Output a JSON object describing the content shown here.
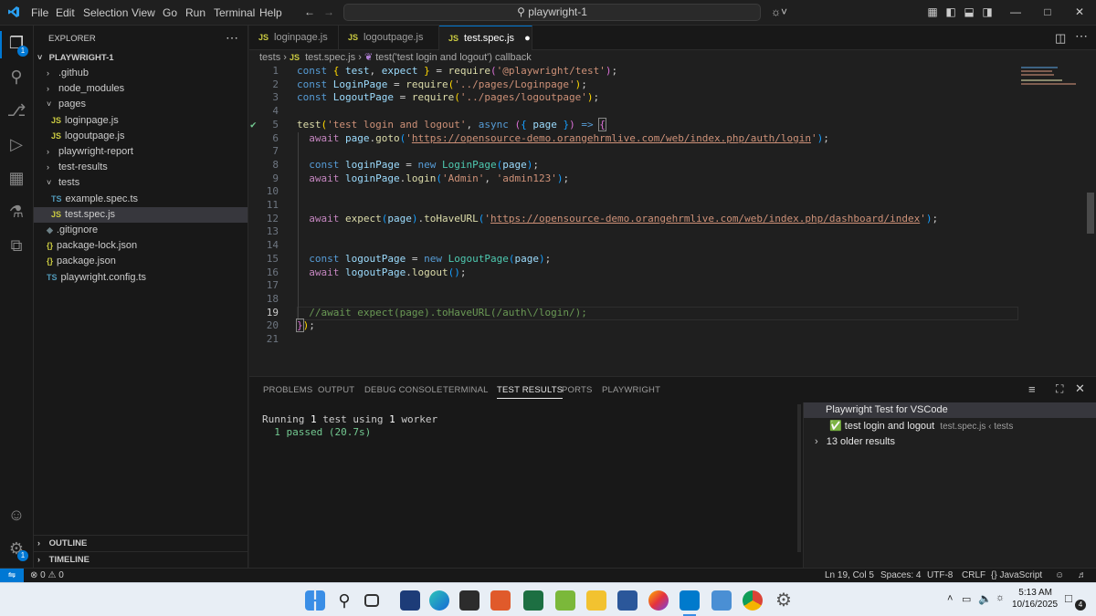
{
  "titlebar": {
    "menus": [
      "File",
      "Edit",
      "Selection",
      "View",
      "Go",
      "Run",
      "Terminal",
      "Help"
    ],
    "search": "playwright-1"
  },
  "activity": {
    "explorer_badge": "1",
    "settings_badge": "1"
  },
  "explorer": {
    "header": "EXPLORER",
    "root": "PLAYWRIGHT-1",
    "items": [
      {
        "label": ".github",
        "kind": "folder-closed",
        "depth": 1
      },
      {
        "label": "node_modules",
        "kind": "folder-closed",
        "depth": 1
      },
      {
        "label": "pages",
        "kind": "folder-open",
        "depth": 1
      },
      {
        "label": "loginpage.js",
        "kind": "js",
        "depth": 2
      },
      {
        "label": "logoutpage.js",
        "kind": "js",
        "depth": 2
      },
      {
        "label": "playwright-report",
        "kind": "folder-closed",
        "depth": 1
      },
      {
        "label": "test-results",
        "kind": "folder-closed",
        "depth": 1
      },
      {
        "label": "tests",
        "kind": "folder-open",
        "depth": 1
      },
      {
        "label": "example.spec.ts",
        "kind": "ts",
        "depth": 2
      },
      {
        "label": "test.spec.js",
        "kind": "js",
        "depth": 2,
        "selected": true
      },
      {
        "label": ".gitignore",
        "kind": "git",
        "depth": 1
      },
      {
        "label": "package-lock.json",
        "kind": "json",
        "depth": 1
      },
      {
        "label": "package.json",
        "kind": "json",
        "depth": 1
      },
      {
        "label": "playwright.config.ts",
        "kind": "ts",
        "depth": 1
      }
    ],
    "outline": "OUTLINE",
    "timeline": "TIMELINE"
  },
  "tabs": [
    {
      "label": "loginpage.js"
    },
    {
      "label": "logoutpage.js"
    },
    {
      "label": "test.spec.js",
      "active": true
    }
  ],
  "breadcrumb": {
    "folder": "tests",
    "file": "test.spec.js",
    "symbol": "test('test login and logout') callback"
  },
  "editor": {
    "current_line": 19,
    "line_numbers": [
      "1",
      "2",
      "3",
      "4",
      "5",
      "6",
      "7",
      "8",
      "9",
      "10",
      "11",
      "12",
      "13",
      "14",
      "15",
      "16",
      "17",
      "18",
      "19",
      "20",
      "21"
    ]
  },
  "panel": {
    "tabs": [
      "PROBLEMS",
      "OUTPUT",
      "DEBUG CONSOLE",
      "TERMINAL",
      "TEST RESULTS",
      "PORTS",
      "PLAYWRIGHT"
    ],
    "active_tab": "TEST RESULTS",
    "output_line1_a": "Running ",
    "output_line1_b": "1",
    "output_line1_c": " test using ",
    "output_line1_d": "1",
    "output_line1_e": " worker",
    "output_line2": "  1 passed (20.7s)",
    "results_header": "Playwright Test for VSCode",
    "result_name": "test login and logout",
    "result_meta": "test.spec.js ‹ tests",
    "older": "13 older results"
  },
  "status": {
    "errors": "0",
    "warnings": "0",
    "position": "Ln 19, Col 5",
    "spaces": "Spaces: 4",
    "encoding": "UTF-8",
    "eol": "CRLF",
    "language": "JavaScript"
  },
  "clock": {
    "time": "5:13 AM",
    "date": "10/16/2025",
    "notifications": "4"
  }
}
